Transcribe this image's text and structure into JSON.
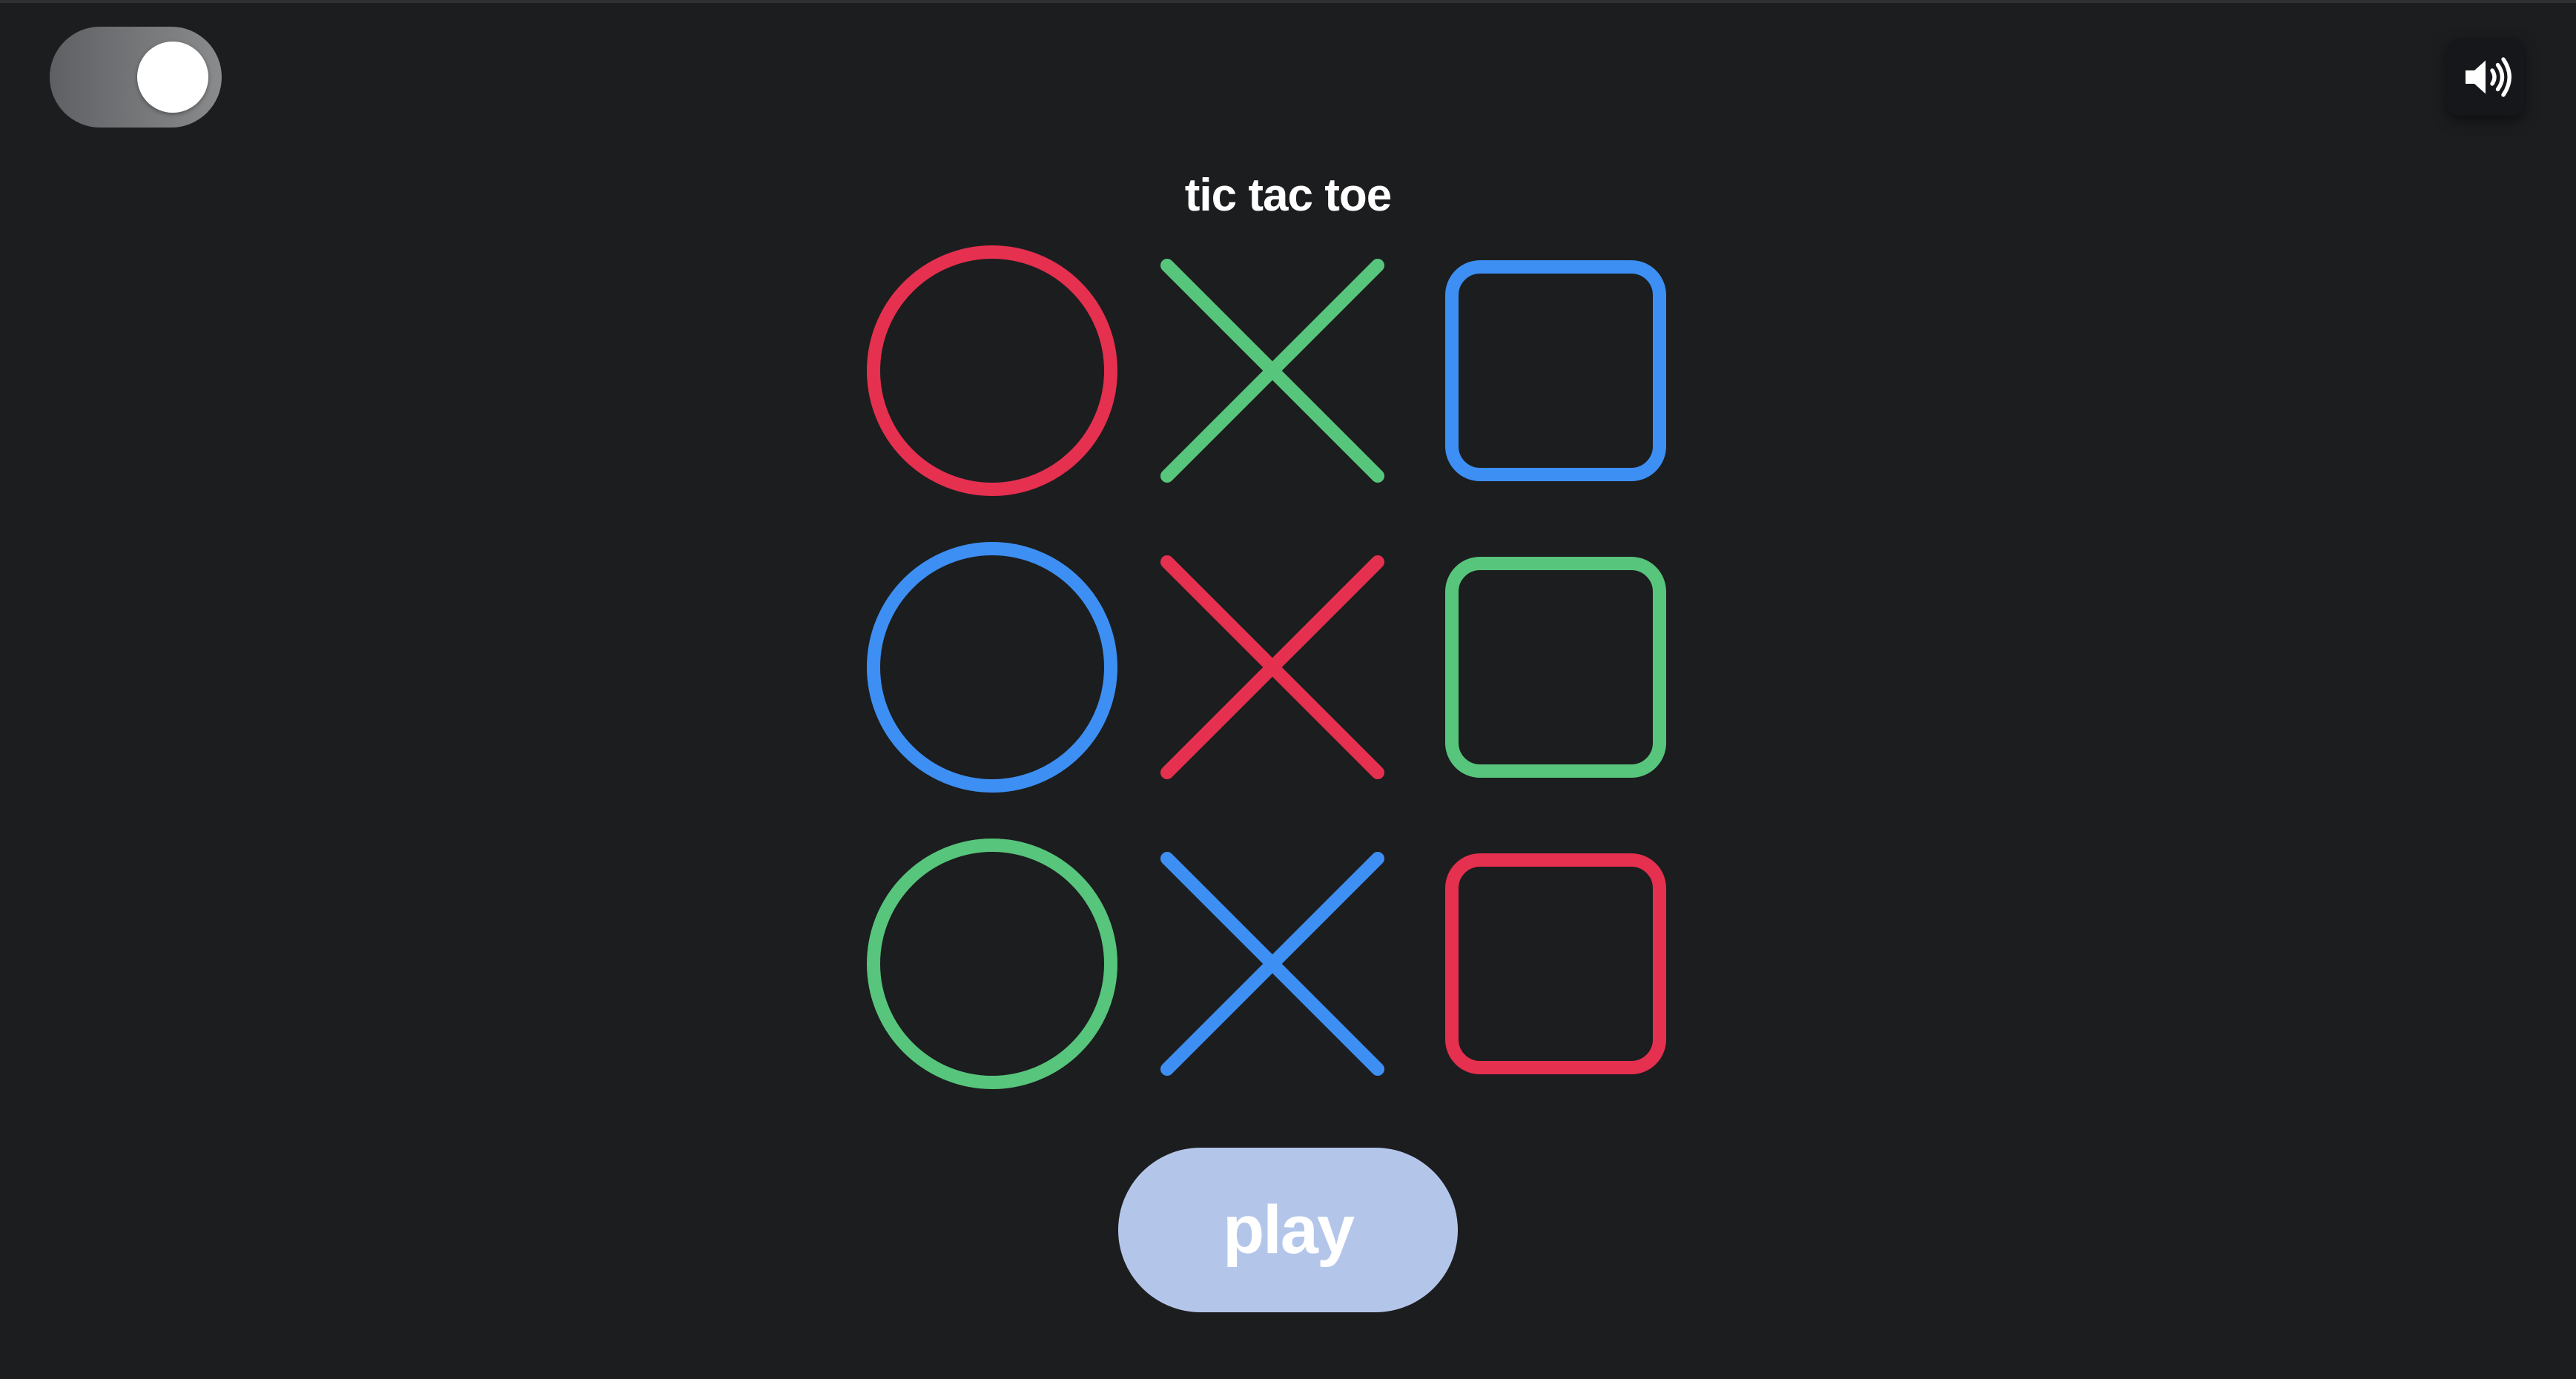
{
  "header": {
    "title": "tic tac toe",
    "theme_toggle": {
      "state": "on"
    },
    "sound_button": {
      "icon": "speaker-volume-icon",
      "state": "sound-on"
    }
  },
  "colors": {
    "background": "#1c1d1f",
    "red": "#e5304f",
    "green": "#57c57c",
    "blue": "#3d8ff3",
    "play_button": "#b3c6ea"
  },
  "board": {
    "rows": [
      [
        {
          "shape": "circle",
          "color": "#e5304f"
        },
        {
          "shape": "cross",
          "color": "#57c57c"
        },
        {
          "shape": "square",
          "color": "#3d8ff3"
        }
      ],
      [
        {
          "shape": "circle",
          "color": "#3d8ff3"
        },
        {
          "shape": "cross",
          "color": "#e5304f"
        },
        {
          "shape": "square",
          "color": "#57c57c"
        }
      ],
      [
        {
          "shape": "circle",
          "color": "#57c57c"
        },
        {
          "shape": "cross",
          "color": "#3d8ff3"
        },
        {
          "shape": "square",
          "color": "#e5304f"
        }
      ]
    ]
  },
  "actions": {
    "play_label": "play"
  }
}
